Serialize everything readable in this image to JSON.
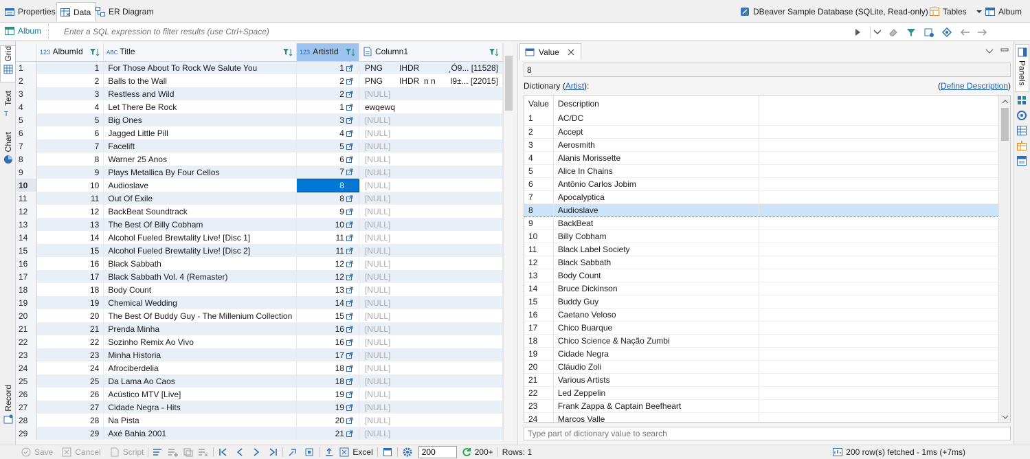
{
  "tabs": [
    {
      "label": "Properties",
      "icon": "properties-icon"
    },
    {
      "label": "Data",
      "icon": "data-grid-icon"
    },
    {
      "label": "ER Diagram",
      "icon": "er-diagram-icon"
    }
  ],
  "connection": {
    "label": "DBeaver Sample Database (SQLite, Read-only)"
  },
  "toolbar_right": {
    "tables_label": "Tables",
    "album_label": "Album"
  },
  "filter": {
    "table_label": "Album",
    "placeholder": "Enter a SQL expression to filter results (use Ctrl+Space)"
  },
  "side_tabs": {
    "grid": "Grid",
    "text": "Text",
    "chart": "Chart",
    "record": "Record"
  },
  "grid": {
    "columns": [
      {
        "label": "AlbumId",
        "type_icon": "123"
      },
      {
        "label": "Title",
        "type_icon": "ABC"
      },
      {
        "label": "ArtistId",
        "type_icon": "123"
      },
      {
        "label": "Column1",
        "type_icon": "binary"
      }
    ],
    "current_row": 10,
    "rows": [
      {
        "n": "1",
        "id": "1",
        "title": "For Those About To Rock We Salute You",
        "artist": "1",
        "c1": [
          "PNG",
          "IHDR",
          "",
          "¸Ó9... [11528]"
        ]
      },
      {
        "n": "2",
        "id": "2",
        "title": "Balls to the Wall",
        "artist": "2",
        "c1": [
          "PNG",
          "IHDR",
          "n   n",
          "l9±... [22015]"
        ]
      },
      {
        "n": "3",
        "id": "3",
        "title": "Restless and Wild",
        "artist": "2",
        "c1null": "[NULL]"
      },
      {
        "n": "4",
        "id": "4",
        "title": "Let There Be Rock",
        "artist": "1",
        "c1text": "ewqewq"
      },
      {
        "n": "5",
        "id": "5",
        "title": "Big Ones",
        "artist": "3",
        "c1null": "[NULL]"
      },
      {
        "n": "6",
        "id": "6",
        "title": "Jagged Little Pill",
        "artist": "4",
        "c1null": "[NULL]"
      },
      {
        "n": "7",
        "id": "7",
        "title": "Facelift",
        "artist": "5",
        "c1null": "[NULL]"
      },
      {
        "n": "8",
        "id": "8",
        "title": "Warner 25 Anos",
        "artist": "6",
        "c1null": "[NULL]"
      },
      {
        "n": "9",
        "id": "9",
        "title": "Plays Metallica By Four Cellos",
        "artist": "7",
        "c1null": "[NULL]"
      },
      {
        "n": "10",
        "id": "10",
        "title": "Audioslave",
        "artist": "8",
        "c1null": "[NULL]"
      },
      {
        "n": "11",
        "id": "11",
        "title": "Out Of Exile",
        "artist": "8",
        "c1null": "[NULL]"
      },
      {
        "n": "12",
        "id": "12",
        "title": "BackBeat Soundtrack",
        "artist": "9",
        "c1null": "[NULL]"
      },
      {
        "n": "13",
        "id": "13",
        "title": "The Best Of Billy Cobham",
        "artist": "10",
        "c1null": "[NULL]"
      },
      {
        "n": "14",
        "id": "14",
        "title": "Alcohol Fueled Brewtality Live! [Disc 1]",
        "artist": "11",
        "c1null": "[NULL]"
      },
      {
        "n": "15",
        "id": "15",
        "title": "Alcohol Fueled Brewtality Live! [Disc 2]",
        "artist": "11",
        "c1null": "[NULL]"
      },
      {
        "n": "16",
        "id": "16",
        "title": "Black Sabbath",
        "artist": "12",
        "c1null": "[NULL]"
      },
      {
        "n": "17",
        "id": "17",
        "title": "Black Sabbath Vol. 4 (Remaster)",
        "artist": "12",
        "c1null": "[NULL]"
      },
      {
        "n": "18",
        "id": "18",
        "title": "Body Count",
        "artist": "13",
        "c1null": "[NULL]"
      },
      {
        "n": "19",
        "id": "19",
        "title": "Chemical Wedding",
        "artist": "14",
        "c1null": "[NULL]"
      },
      {
        "n": "20",
        "id": "20",
        "title": "The Best Of Buddy Guy - The Millenium Collection",
        "artist": "15",
        "c1null": "[NULL]"
      },
      {
        "n": "21",
        "id": "21",
        "title": "Prenda Minha",
        "artist": "16",
        "c1null": "[NULL]"
      },
      {
        "n": "22",
        "id": "22",
        "title": "Sozinho Remix Ao Vivo",
        "artist": "16",
        "c1null": "[NULL]"
      },
      {
        "n": "23",
        "id": "23",
        "title": "Minha Historia",
        "artist": "17",
        "c1null": "[NULL]"
      },
      {
        "n": "24",
        "id": "24",
        "title": "Afrociberdelia",
        "artist": "18",
        "c1null": "[NULL]"
      },
      {
        "n": "25",
        "id": "25",
        "title": "Da Lama Ao Caos",
        "artist": "18",
        "c1null": "[NULL]"
      },
      {
        "n": "26",
        "id": "26",
        "title": "Acústico MTV [Live]",
        "artist": "19",
        "c1null": "[NULL]"
      },
      {
        "n": "27",
        "id": "27",
        "title": "Cidade Negra - Hits",
        "artist": "19",
        "c1null": "[NULL]"
      },
      {
        "n": "28",
        "id": "28",
        "title": "Na Pista",
        "artist": "20",
        "c1null": "[NULL]"
      },
      {
        "n": "29",
        "id": "29",
        "title": "Axé Bahia 2001",
        "artist": "21",
        "c1null": "[NULL]"
      }
    ]
  },
  "value_panel": {
    "tab_label": "Value",
    "current_value": "8",
    "dictionary_label": "Dictionary",
    "dictionary_link": "Artist",
    "define_link": "Define Description",
    "columns": [
      "Value",
      "Description"
    ],
    "selected_value": "8",
    "rows": [
      {
        "v": "1",
        "d": "AC/DC"
      },
      {
        "v": "2",
        "d": "Accept"
      },
      {
        "v": "3",
        "d": "Aerosmith"
      },
      {
        "v": "4",
        "d": "Alanis Morissette"
      },
      {
        "v": "5",
        "d": "Alice In Chains"
      },
      {
        "v": "6",
        "d": "Antônio Carlos Jobim"
      },
      {
        "v": "7",
        "d": "Apocalyptica"
      },
      {
        "v": "8",
        "d": "Audioslave"
      },
      {
        "v": "9",
        "d": "BackBeat"
      },
      {
        "v": "10",
        "d": "Billy Cobham"
      },
      {
        "v": "11",
        "d": "Black Label Society"
      },
      {
        "v": "12",
        "d": "Black Sabbath"
      },
      {
        "v": "13",
        "d": "Body Count"
      },
      {
        "v": "14",
        "d": "Bruce Dickinson"
      },
      {
        "v": "15",
        "d": "Buddy Guy"
      },
      {
        "v": "16",
        "d": "Caetano Veloso"
      },
      {
        "v": "17",
        "d": "Chico Buarque"
      },
      {
        "v": "18",
        "d": "Chico Science & Nação Zumbi"
      },
      {
        "v": "19",
        "d": "Cidade Negra"
      },
      {
        "v": "20",
        "d": "Cláudio Zoli"
      },
      {
        "v": "21",
        "d": "Various Artists"
      },
      {
        "v": "22",
        "d": "Led Zeppelin"
      },
      {
        "v": "23",
        "d": "Frank Zappa & Captain Beefheart"
      },
      {
        "v": "24",
        "d": "Marcos Valle"
      }
    ],
    "search_placeholder": "Type part of dictionary value to search"
  },
  "right_bar": {
    "panels_label": "Panels"
  },
  "bottom": {
    "save": "Save",
    "cancel": "Cancel",
    "script": "Script",
    "excel": "Excel",
    "fetch_size": "200",
    "fetch_next": "200+",
    "rows_label": "Rows: 1",
    "status": "200 row(s) fetched - 1ms (+7ms)"
  },
  "colors": {
    "accent": "#0078d7",
    "selected_header": "#9cc4ee",
    "row_alt": "#e9eff7",
    "null_text": "#a9a9a9",
    "link": "#1a5fb4"
  }
}
